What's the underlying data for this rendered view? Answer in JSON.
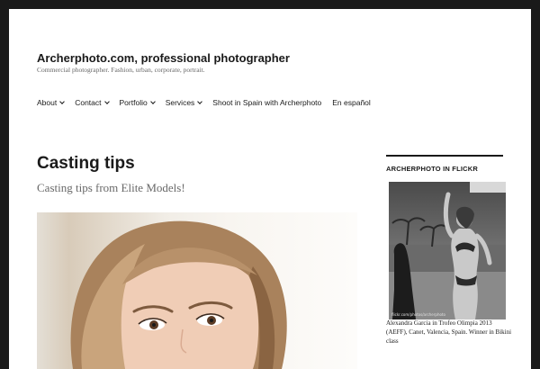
{
  "header": {
    "site_title": "Archerphoto.com, professional photographer",
    "site_description": "Commercial photographer. Fashion, urban, corporate, portrait."
  },
  "nav": {
    "items": [
      {
        "label": "About",
        "has_submenu": true
      },
      {
        "label": "Contact",
        "has_submenu": true
      },
      {
        "label": "Portfolio",
        "has_submenu": true
      },
      {
        "label": "Services",
        "has_submenu": true
      },
      {
        "label": "Shoot in Spain with Archerphoto",
        "has_submenu": false
      },
      {
        "label": "En español",
        "has_submenu": false
      }
    ]
  },
  "entry": {
    "title": "Casting tips",
    "subtitle": "Casting tips from Elite Models!"
  },
  "sidebar": {
    "widget_title": "ARCHERPHOTO IN FLICKR",
    "photo_watermark": "flickr.com/photos/archerphoto",
    "photo_caption": "Alexandra Garcia in Trofeo Olimpia 2013 (AEFF), Canet, Valencia, Spain. Winner in Bikini class"
  },
  "colors": {
    "page_frame": "#1a1a1a",
    "background": "#ffffff",
    "text": "#1a1a1a",
    "muted_text": "#686868"
  }
}
